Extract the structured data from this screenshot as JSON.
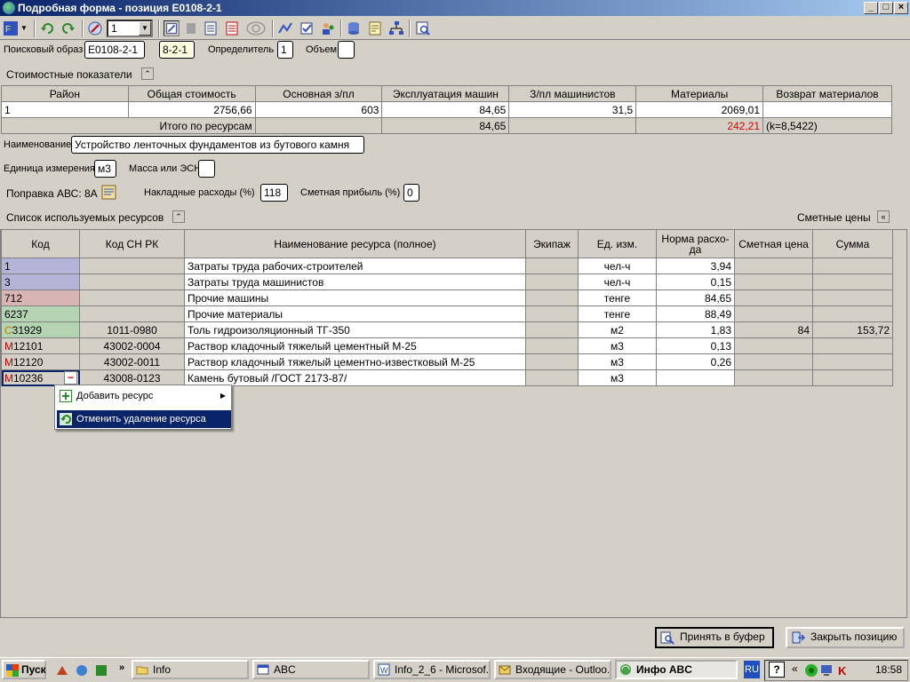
{
  "window": {
    "title": "Подробная форма - позиция Е0108-2-1"
  },
  "toolbar": {
    "combo_value": "1"
  },
  "form": {
    "search_label": "Поисковый образ",
    "search_value": "Е0108-2-1",
    "code2_value": "8-2-1",
    "determinant_label": "Определитель",
    "determinant_value": "1",
    "volume_label": "Объем",
    "volume_value": "",
    "cost_section_title": "Стоимостные показатели",
    "name_label": "Наименование",
    "name_value": "Устройство ленточных фундаментов из бутового камня",
    "unit_label": "Единица измерения",
    "unit_value": "м3",
    "mass_label": "Масса или ЭСН",
    "mass_value": "",
    "correction_label": "Поправка АВС: 8А",
    "overhead_label": "Накладные расходы (%)",
    "overhead_value": "118",
    "profit_label": "Сметная прибыль (%)",
    "profit_value": "0",
    "resources_title": "Список используемых ресурсов",
    "prices_title": "Сметные цены"
  },
  "cost_table": {
    "headers": [
      "Район",
      "Общая стоимость",
      "Основная з/пл",
      "Эксплуатация машин",
      "З/пл машинистов",
      "Материалы",
      "Возврат материалов"
    ],
    "row": [
      "1",
      "2756,66",
      "603",
      "84,65",
      "31,5",
      "2069,01",
      ""
    ],
    "total_label": "Итого по ресурсам",
    "total_machines": "84,65",
    "total_materials": "242,21",
    "total_k": "(k=8,5422)"
  },
  "resource_table": {
    "headers": [
      "Код",
      "Код СН РК",
      "Наименование ресурса (полное)",
      "Экипаж",
      "Ед. изм.",
      "Норма расхо-да",
      "Сметная цена",
      "Сумма"
    ],
    "rows": [
      {
        "prefix": "",
        "code": "1",
        "sn": "",
        "name": "Затраты труда рабочих-строителей",
        "crew": "",
        "unit": "чел-ч",
        "norm": "3,94",
        "price": "",
        "sum": ""
      },
      {
        "prefix": "",
        "code": "3",
        "sn": "",
        "name": "Затраты труда машинистов",
        "crew": "",
        "unit": "чел-ч",
        "norm": "0,15",
        "price": "",
        "sum": ""
      },
      {
        "prefix": "",
        "code": "712",
        "sn": "",
        "name": "Прочие машины",
        "crew": "",
        "unit": "тенге",
        "norm": "84,65",
        "price": "",
        "sum": ""
      },
      {
        "prefix": "",
        "code": "6237",
        "sn": "",
        "name": "Прочие материалы",
        "crew": "",
        "unit": "тенге",
        "norm": "88,49",
        "price": "",
        "sum": ""
      },
      {
        "prefix": "С",
        "code": "31929",
        "sn": "1011-0980",
        "name": "Толь гидроизоляционный ТГ-350",
        "crew": "",
        "unit": "м2",
        "norm": "1,83",
        "price": "84",
        "sum": "153,72"
      },
      {
        "prefix": "М",
        "code": "12101",
        "sn": "43002-0004",
        "name": "Раствор кладочный тяжелый цементный М-25",
        "crew": "",
        "unit": "м3",
        "norm": "0,13",
        "price": "",
        "sum": ""
      },
      {
        "prefix": "М",
        "code": "12120",
        "sn": "43002-0011",
        "name": "Раствор кладочный тяжелый цементно-известковый М-25",
        "crew": "",
        "unit": "м3",
        "norm": "0,26",
        "price": "",
        "sum": ""
      },
      {
        "prefix": "М",
        "code": "10236",
        "sn": "43008-0123",
        "name": "Камень бутовый /ГОСТ 2173-87/",
        "crew": "",
        "unit": "м3",
        "norm": "",
        "price": "",
        "sum": ""
      }
    ]
  },
  "context_menu": {
    "add_resource": "Добавить ресурс",
    "undo_delete": "Отменить удаление ресурса"
  },
  "buttons": {
    "accept": "Принять в буфер",
    "close": "Закрыть позицию"
  },
  "taskbar": {
    "start": "Пуск",
    "tasks": [
      "Info",
      "ABC",
      "Info_2_6 - Microsof...",
      "Входящие - Outloo...",
      "Инфо ABC"
    ],
    "lang": "RU",
    "clock": "18:58"
  }
}
